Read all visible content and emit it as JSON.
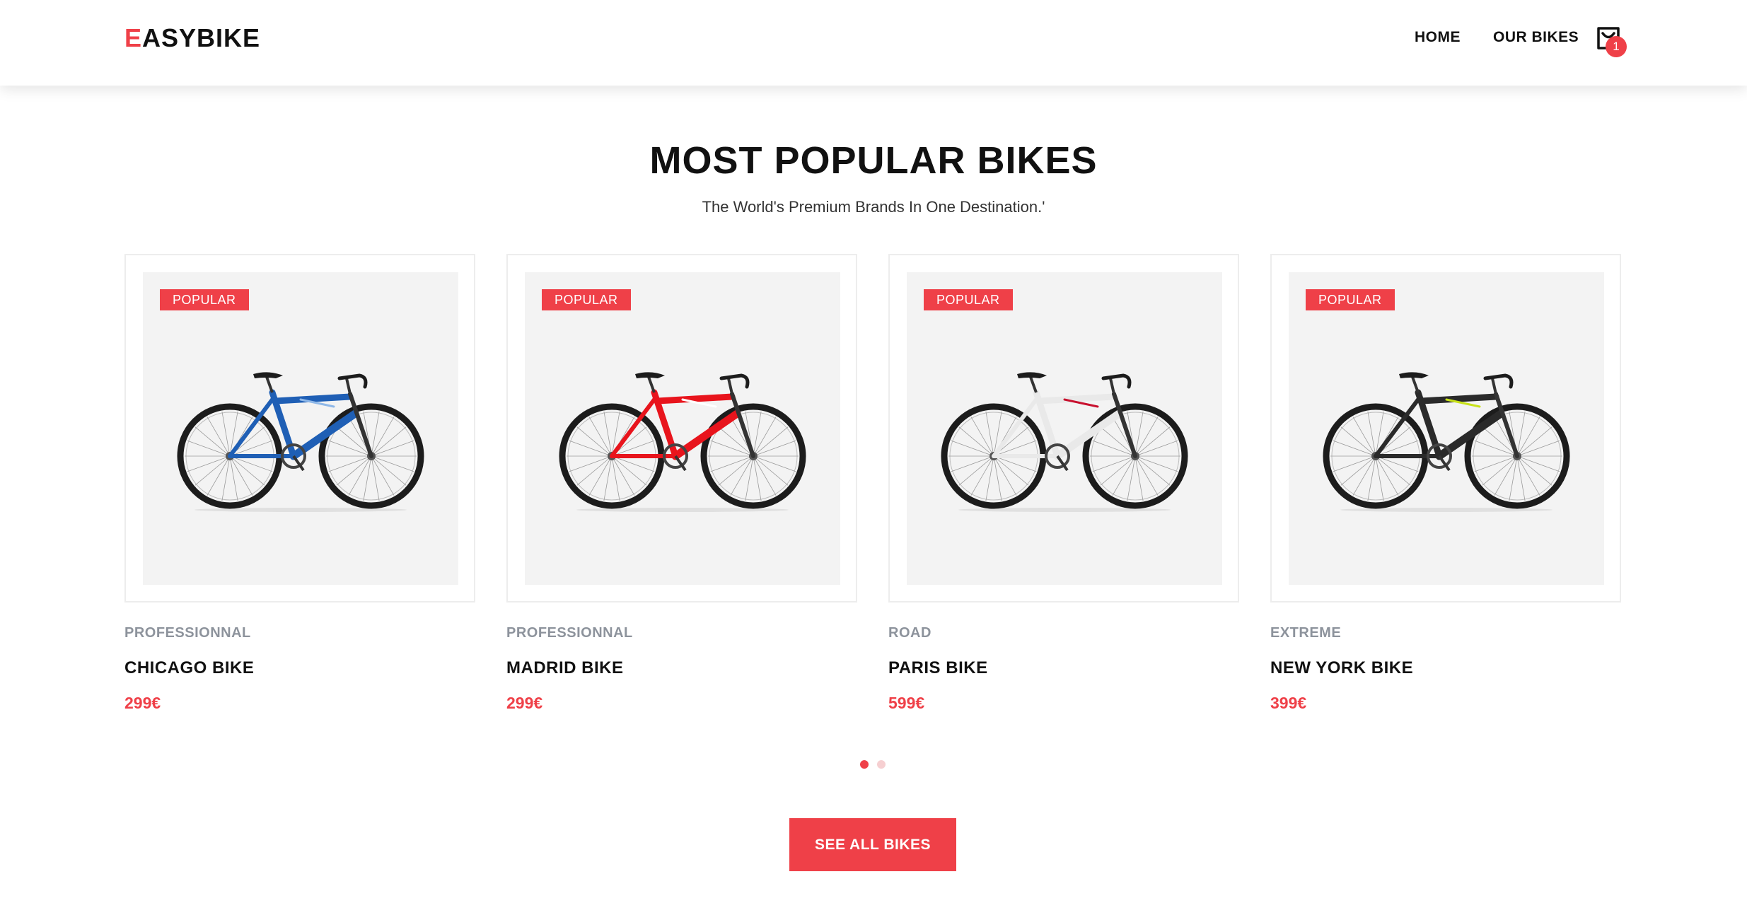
{
  "brand": {
    "logo_first": "E",
    "logo_rest": "ASYBIKE"
  },
  "nav": {
    "home": "HOME",
    "our_bikes": "OUR BIKES",
    "cart_count": "1"
  },
  "section": {
    "title": "MOST POPULAR BIKES",
    "subtitle": "The World's Premium Brands In One Destination.'"
  },
  "products": [
    {
      "badge": "POPULAR",
      "category": "PROFESSIONNAL",
      "name": "CHICAGO BIKE",
      "price": "299€",
      "frame_color": "#1f5fb5",
      "accent_color": "#8fb8e8"
    },
    {
      "badge": "POPULAR",
      "category": "PROFESSIONNAL",
      "name": "MADRID BIKE",
      "price": "299€",
      "frame_color": "#e8141c",
      "accent_color": "#ffffff"
    },
    {
      "badge": "POPULAR",
      "category": "ROAD",
      "name": "PARIS BIKE",
      "price": "599€",
      "frame_color": "#e9e9e9",
      "accent_color": "#c8102e"
    },
    {
      "badge": "POPULAR",
      "category": "EXTREME",
      "name": "NEW YORK BIKE",
      "price": "399€",
      "frame_color": "#2a2a2a",
      "accent_color": "#c8e21a"
    }
  ],
  "carousel": {
    "pages": 2,
    "active": 1
  },
  "cta": {
    "label": "SEE ALL BIKES"
  },
  "colors": {
    "accent": "#ef4048",
    "card_bg": "#f3f3f3",
    "muted": "#8d939c"
  }
}
